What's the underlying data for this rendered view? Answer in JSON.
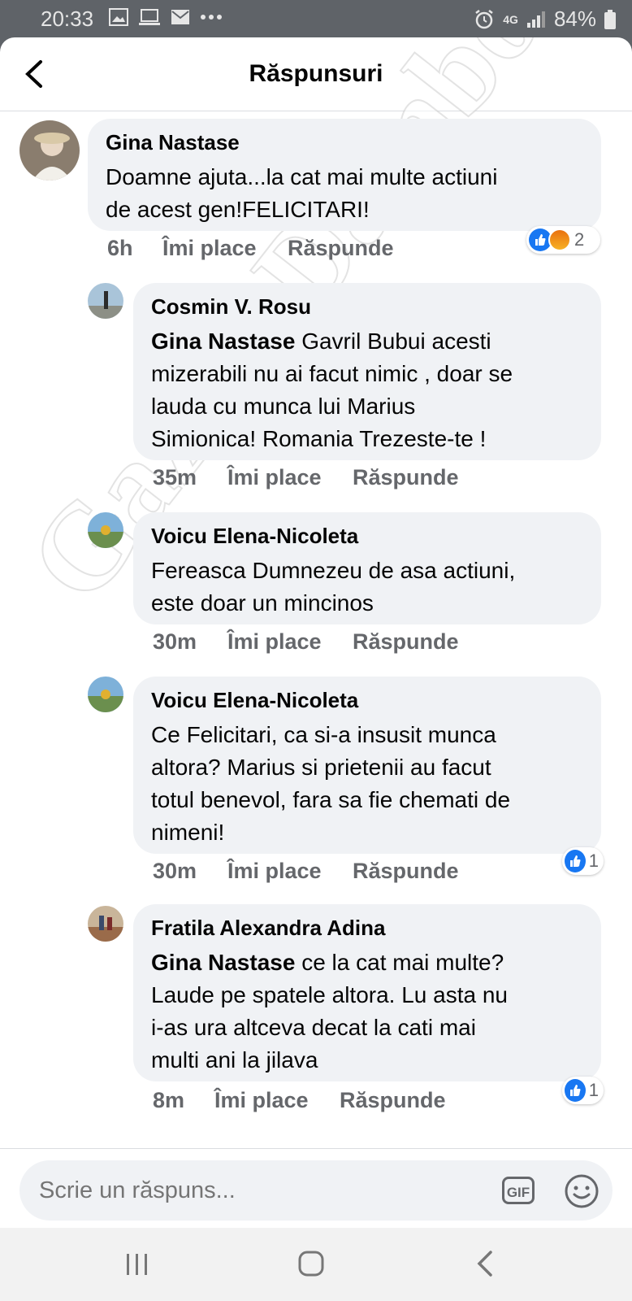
{
  "status_bar": {
    "time": "20:33",
    "battery": "84%",
    "network": "4G"
  },
  "header": {
    "title": "Răspunsuri"
  },
  "comments": [
    {
      "author": "Gina Nastase",
      "lines": [
        "Doamne ajuta...la cat mai multe actiuni",
        "de acest gen!FELICITARI!"
      ],
      "time": "6h",
      "like_label": "Îmi place",
      "reply_label": "Răspunde",
      "reaction_count": "2"
    },
    {
      "author": "Cosmin V. Rosu",
      "mention": "Gina Nastase",
      "lines": [
        " Gavril Bubui acesti",
        "mizerabili nu ai facut nimic , doar se",
        "lauda cu munca lui Marius",
        "Simionica! Romania Trezeste-te !"
      ],
      "time": "35m",
      "like_label": "Îmi place",
      "reply_label": "Răspunde"
    },
    {
      "author": "Voicu Elena-Nicoleta",
      "lines": [
        "Fereasca Dumnezeu de asa actiuni,",
        "este doar un mincinos"
      ],
      "time": "30m",
      "like_label": "Îmi place",
      "reply_label": "Răspunde"
    },
    {
      "author": "Voicu Elena-Nicoleta",
      "lines": [
        "Ce Felicitari, ca si-a insusit munca",
        "altora? Marius si prietenii au facut",
        "totul benevol, fara sa fie chemati de",
        "nimeni!"
      ],
      "time": "30m",
      "like_label": "Îmi place",
      "reply_label": "Răspunde",
      "reaction_count": "1"
    },
    {
      "author": "Fratila Alexandra Adina",
      "mention": "Gina Nastase",
      "lines": [
        " ce la cat mai multe?",
        "Laude pe spatele altora. Lu asta nu",
        "i-as ura altceva decat la cati mai",
        "multi ani la jilava"
      ],
      "time": "8m",
      "like_label": "Îmi place",
      "reply_label": "Răspunde",
      "reaction_count": "1"
    }
  ],
  "composer": {
    "placeholder": "Scrie un răspuns...",
    "gif_label": "GIF"
  },
  "watermark": "GazetaDambovitei.ro"
}
